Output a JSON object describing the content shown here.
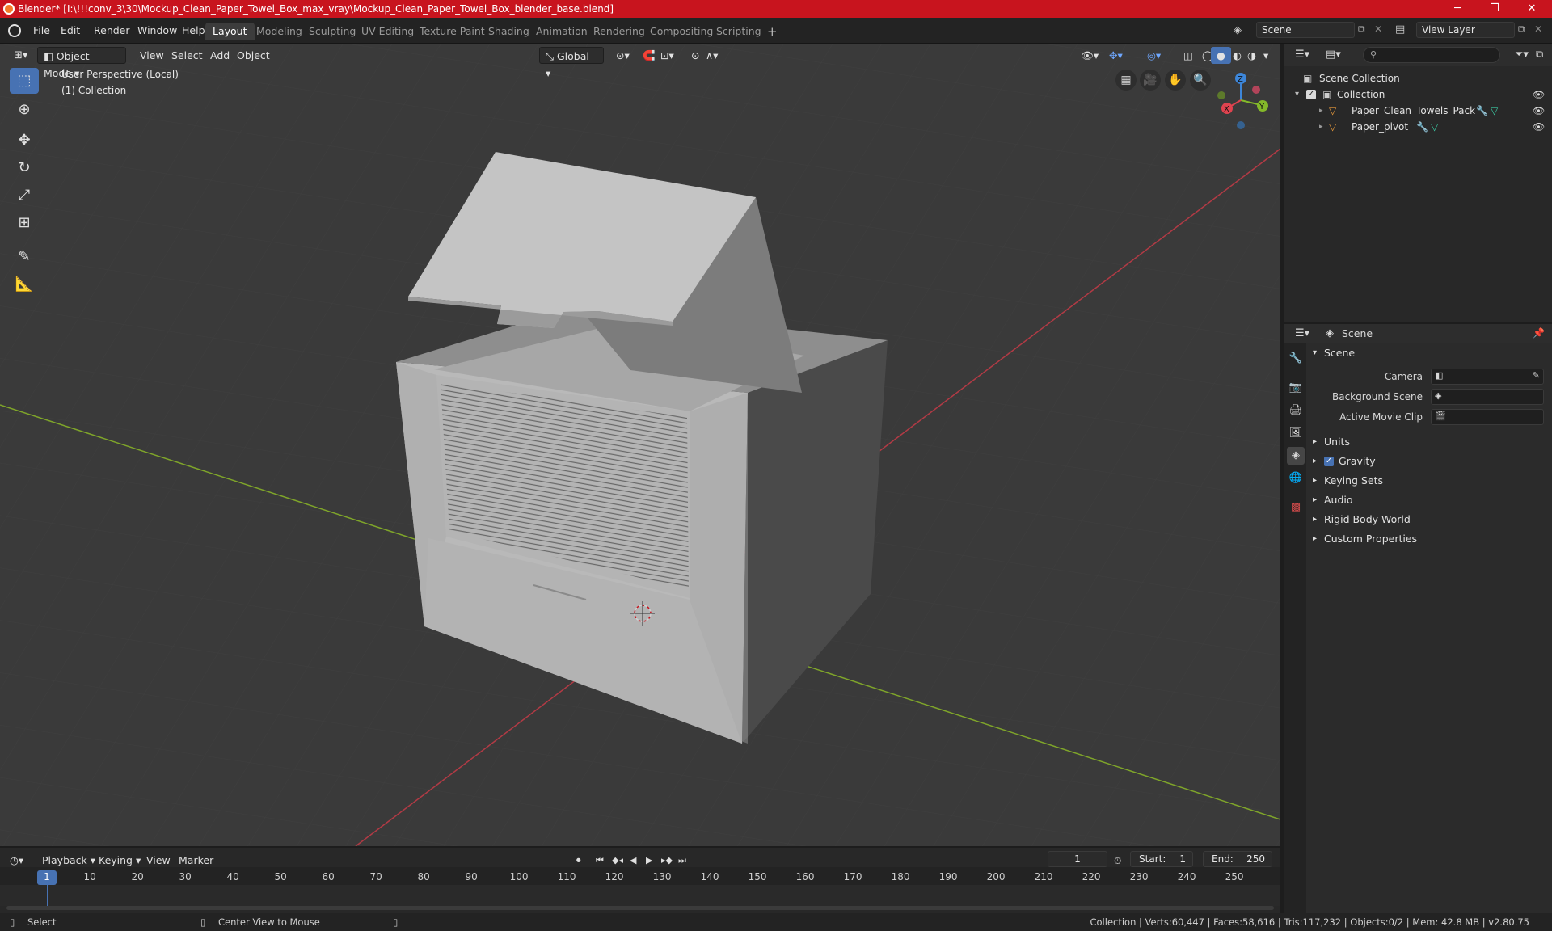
{
  "window": {
    "title": "Blender* [I:\\!!!conv_3\\30\\Mockup_Clean_Paper_Towel_Box_max_vray\\Mockup_Clean_Paper_Towel_Box_blender_base.blend]",
    "minimize": "─",
    "maximize": "❐",
    "close": "✕"
  },
  "menu": {
    "items": [
      "File",
      "Edit",
      "Render",
      "Window",
      "Help"
    ],
    "workspaces": [
      "Layout",
      "Modeling",
      "Sculpting",
      "UV Editing",
      "Texture Paint",
      "Shading",
      "Animation",
      "Rendering",
      "Compositing",
      "Scripting"
    ],
    "active_workspace": "Layout",
    "add_workspace": "+",
    "scene_value": "Scene",
    "view_layer_value": "View Layer"
  },
  "viewport": {
    "mode": "Object Mode",
    "menus": [
      "View",
      "Select",
      "Add",
      "Object"
    ],
    "transform_orientation": "Global",
    "overlay_line1": "User Perspective (Local)",
    "overlay_line2": "(1) Collection",
    "gizmo_axes": {
      "x": "X",
      "y": "Y",
      "z": "Z"
    }
  },
  "outliner": {
    "root": "Scene Collection",
    "collection": "Collection",
    "objects": [
      "Paper_Clean_Towels_Pack",
      "Paper_pivot"
    ]
  },
  "properties": {
    "header_title": "Scene",
    "panel_title": "Scene",
    "fields": [
      {
        "label": "Camera"
      },
      {
        "label": "Background Scene"
      },
      {
        "label": "Active Movie Clip"
      }
    ],
    "sections": [
      "Units",
      "Gravity",
      "Keying Sets",
      "Audio",
      "Rigid Body World",
      "Custom Properties"
    ],
    "gravity_checked": true
  },
  "timeline": {
    "menus": [
      "Playback",
      "Keying",
      "View",
      "Marker"
    ],
    "current_frame": "1",
    "start_label": "Start:",
    "start_value": "1",
    "end_label": "End:",
    "end_value": "250",
    "ticks": [
      "1",
      "10",
      "20",
      "30",
      "40",
      "50",
      "60",
      "70",
      "80",
      "90",
      "100",
      "110",
      "120",
      "130",
      "140",
      "150",
      "160",
      "170",
      "180",
      "190",
      "200",
      "210",
      "220",
      "230",
      "240",
      "250"
    ]
  },
  "statusbar": {
    "select": "Select",
    "center": "Center View to Mouse",
    "stats": "Collection | Verts:60,447 | Faces:58,616 | Tris:117,232 | Objects:0/2 | Mem: 42.8 MB | v2.80.75"
  },
  "colors": {
    "accent": "#4772b3",
    "titlebar": "#c8141e",
    "x_axis": "#e0434f",
    "y_axis": "#84b92a",
    "z_axis": "#3d86d9"
  }
}
